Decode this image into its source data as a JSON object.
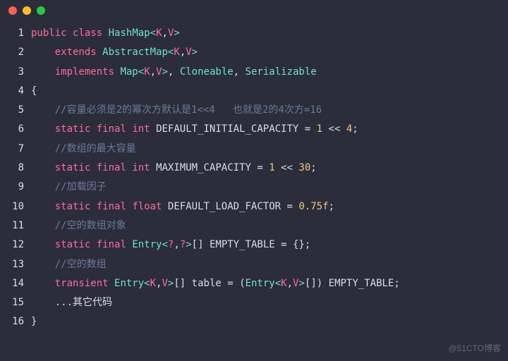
{
  "window": {
    "dots": {
      "red": "#ff5f57",
      "yellow": "#febc2e",
      "green": "#28c840"
    }
  },
  "watermark": "@51CTO博客",
  "lines": [
    {
      "n": "1",
      "html": "<span class='kw'>public</span> <span class='kw'>class</span> <span class='type'>HashMap</span><span class='angle'>&lt;</span><span class='gen'>K</span><span class='punct'>,</span><span class='gen'>V</span><span class='angle'>&gt;</span>"
    },
    {
      "n": "2",
      "html": "    <span class='kw'>extends</span> <span class='type'>AbstractMap</span><span class='angle'>&lt;</span><span class='gen'>K</span><span class='punct'>,</span><span class='gen'>V</span><span class='angle'>&gt;</span>"
    },
    {
      "n": "3",
      "html": "    <span class='kw'>implements</span> <span class='type'>Map</span><span class='angle'>&lt;</span><span class='gen'>K</span><span class='punct'>,</span><span class='gen'>V</span><span class='angle'>&gt;</span><span class='punct'>,</span> <span class='type'>Cloneable</span><span class='punct'>,</span> <span class='type'>Serializable</span>"
    },
    {
      "n": "4",
      "html": "<span class='brace'>{</span>"
    },
    {
      "n": "5",
      "html": "    <span class='cmt'>//容量必须是2的幂次方默认是1&lt;&lt;4   也就是2的4次方=16</span>"
    },
    {
      "n": "6",
      "html": "    <span class='kw'>static</span> <span class='kw'>final</span> <span class='kw'>int</span> <span class='name'>DEFAULT_INITIAL_CAPACITY</span> <span class='punct'>=</span> <span class='num'>1</span> <span class='punct'>&lt;&lt;</span> <span class='num'>4</span><span class='punct'>;</span>"
    },
    {
      "n": "7",
      "html": "    <span class='cmt'>//数组的最大容量</span>"
    },
    {
      "n": "8",
      "html": "    <span class='kw'>static</span> <span class='kw'>final</span> <span class='kw'>int</span> <span class='name'>MAXIMUM_CAPACITY</span> <span class='punct'>=</span> <span class='num'>1</span> <span class='punct'>&lt;&lt;</span> <span class='num'>30</span><span class='punct'>;</span>"
    },
    {
      "n": "9",
      "html": "    <span class='cmt'>//加载因子</span>"
    },
    {
      "n": "10",
      "html": "    <span class='kw'>static</span> <span class='kw'>final</span> <span class='kw'>float</span> <span class='name'>DEFAULT_LOAD_FACTOR</span> <span class='punct'>=</span> <span class='num'>0.75f</span><span class='punct'>;</span>"
    },
    {
      "n": "11",
      "html": "    <span class='cmt'>//空的数组对象</span>"
    },
    {
      "n": "12",
      "html": "    <span class='kw'>static</span> <span class='kw'>final</span> <span class='type'>Entry</span><span class='angle'>&lt;</span><span class='gen'>?</span><span class='punct'>,</span><span class='gen'>?</span><span class='angle'>&gt;</span><span class='punct'>[]</span> <span class='name'>EMPTY_TABLE</span> <span class='punct'>=</span> <span class='brace'>{}</span><span class='punct'>;</span>"
    },
    {
      "n": "13",
      "html": "    <span class='cmt'>//空的数组</span>"
    },
    {
      "n": "14",
      "html": "    <span class='kw'>transient</span> <span class='type'>Entry</span><span class='angle'>&lt;</span><span class='gen'>K</span><span class='punct'>,</span><span class='gen'>V</span><span class='angle'>&gt;</span><span class='punct'>[]</span> <span class='name'>table</span> <span class='punct'>=</span> <span class='punct'>(</span><span class='type'>Entry</span><span class='angle'>&lt;</span><span class='gen'>K</span><span class='punct'>,</span><span class='gen'>V</span><span class='angle'>&gt;</span><span class='punct'>[])</span> <span class='name'>EMPTY_TABLE</span><span class='punct'>;</span>"
    },
    {
      "n": "15",
      "html": "    <span class='punct'>...</span><span class='name'>其它代码</span>"
    },
    {
      "n": "16",
      "html": "<span class='brace'>}</span>"
    }
  ]
}
